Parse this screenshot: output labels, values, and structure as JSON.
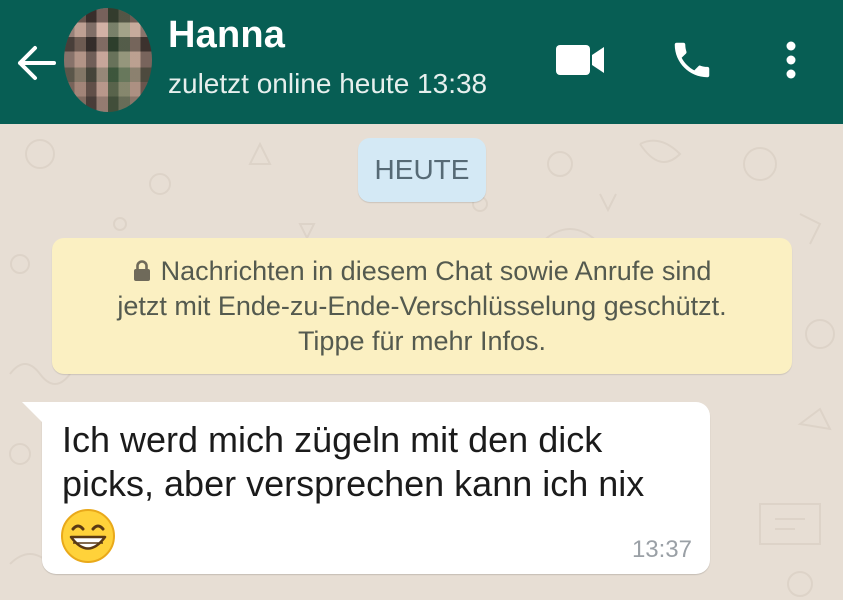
{
  "header": {
    "contact_name": "Hanna",
    "status": "zuletzt online heute 13:38",
    "icons": [
      "back-arrow-icon",
      "video-call-icon",
      "phone-icon",
      "more-options-icon"
    ],
    "background_color": "#075e54"
  },
  "chat": {
    "date_label": "HEUTE",
    "encryption_notice": {
      "line1": "Nachrichten in diesem Chat sowie Anrufe sind",
      "line2": "jetzt mit Ende-zu-Ende-Verschlüsselung geschützt.",
      "line3": "Tippe für mehr Infos.",
      "icon": "lock-icon"
    },
    "messages": [
      {
        "direction": "incoming",
        "text": "Ich werd mich zügeln mit den dick picks, aber versprechen kann ich nix",
        "emoji": "grinning-face-icon",
        "time": "13:37"
      }
    ]
  }
}
